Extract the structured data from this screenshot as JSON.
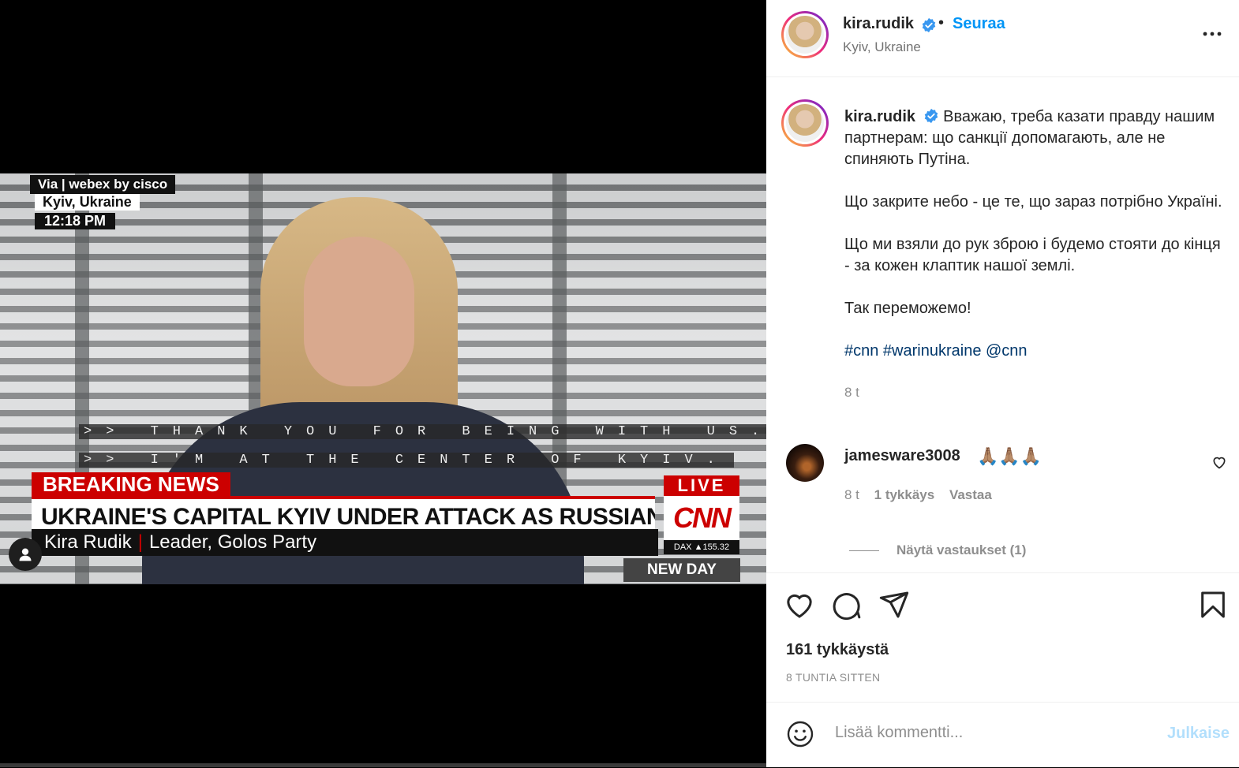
{
  "video": {
    "bug": "Via | webex by cisco",
    "location": "Kyiv, Ukraine",
    "time": "12:18 PM",
    "cc_line1": ">> THANK YOU FOR BEING WITH US.",
    "cc_line2": ">> I'M AT THE CENTER OF KYIV.",
    "breaking": "BREAKING NEWS",
    "headline": "UKRAINE'S CAPITAL KYIV UNDER ATTACK AS RUSSIANS ADVANCE",
    "name": "Kira Rudik",
    "title": "Leader, Golos Party",
    "live": "LIVE",
    "network": "CNN",
    "dax": "DAX ▲155.32",
    "show": "NEW DAY"
  },
  "header": {
    "username": "kira.rudik",
    "dot": "•",
    "follow": "Seuraa",
    "location": "Kyiv, Ukraine"
  },
  "caption": {
    "username": "kira.rudik",
    "p1": "Вважаю, треба казати правду нашим партнерам: що санкції допомагають, але не спиняють Путіна.",
    "p2": "Що закрите небо - це те, що зараз потрібно Україні.",
    "p3": "Що ми взяли до рук зброю і будемо стояти до кінця - за кожен клаптик нашої землі.",
    "p4": "Так переможемо!",
    "hashtags": "#cnn #warinukraine @cnn",
    "time": "8 t"
  },
  "comment": {
    "username": "jamesware3008",
    "text": "🙏🏽🙏🏽🙏🏽",
    "time": "8 t",
    "likes": "1 tykkäys",
    "reply": "Vastaa",
    "view_replies": "Näytä vastaukset (1)"
  },
  "stats": {
    "likes": "161 tykkäystä",
    "posted": "8 TUNTIA SITTEN"
  },
  "composer": {
    "placeholder": "Lisää kommentti...",
    "publish": "Julkaise"
  },
  "colors": {
    "accent": "#0095f6",
    "cnn_red": "#cc0000",
    "hashtag": "#00376b"
  }
}
